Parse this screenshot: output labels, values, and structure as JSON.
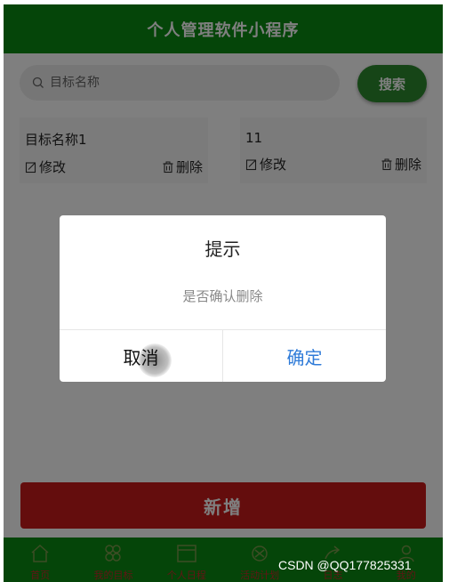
{
  "header": {
    "title": "个人管理软件小程序"
  },
  "search": {
    "placeholder": "目标名称",
    "button_label": "搜索"
  },
  "cards": [
    {
      "title": "目标名称1",
      "edit_label": "修改",
      "delete_label": "删除"
    },
    {
      "title": "11",
      "edit_label": "修改",
      "delete_label": "删除"
    }
  ],
  "add_button": {
    "label": "新增"
  },
  "tabbar": {
    "items": [
      {
        "label": "首页",
        "icon": "home-icon"
      },
      {
        "label": "我的目标",
        "icon": "grid-icon"
      },
      {
        "label": "个人日程",
        "icon": "calendar-icon"
      },
      {
        "label": "活动计划",
        "icon": "plan-icon"
      },
      {
        "label": "日志",
        "icon": "share-icon"
      },
      {
        "label": "我的",
        "icon": "user-icon"
      }
    ]
  },
  "modal": {
    "title": "提示",
    "content": "是否确认删除",
    "cancel_label": "取消",
    "confirm_label": "确定"
  },
  "watermark": {
    "text": "CSDN @QQ177825331"
  },
  "colors": {
    "header_green": "#0a8a12",
    "search_button_green": "#2c8a2e",
    "add_button_red": "#c91a1a",
    "confirm_blue": "#2f7bd8",
    "tab_label_red": "#c42a2a"
  }
}
